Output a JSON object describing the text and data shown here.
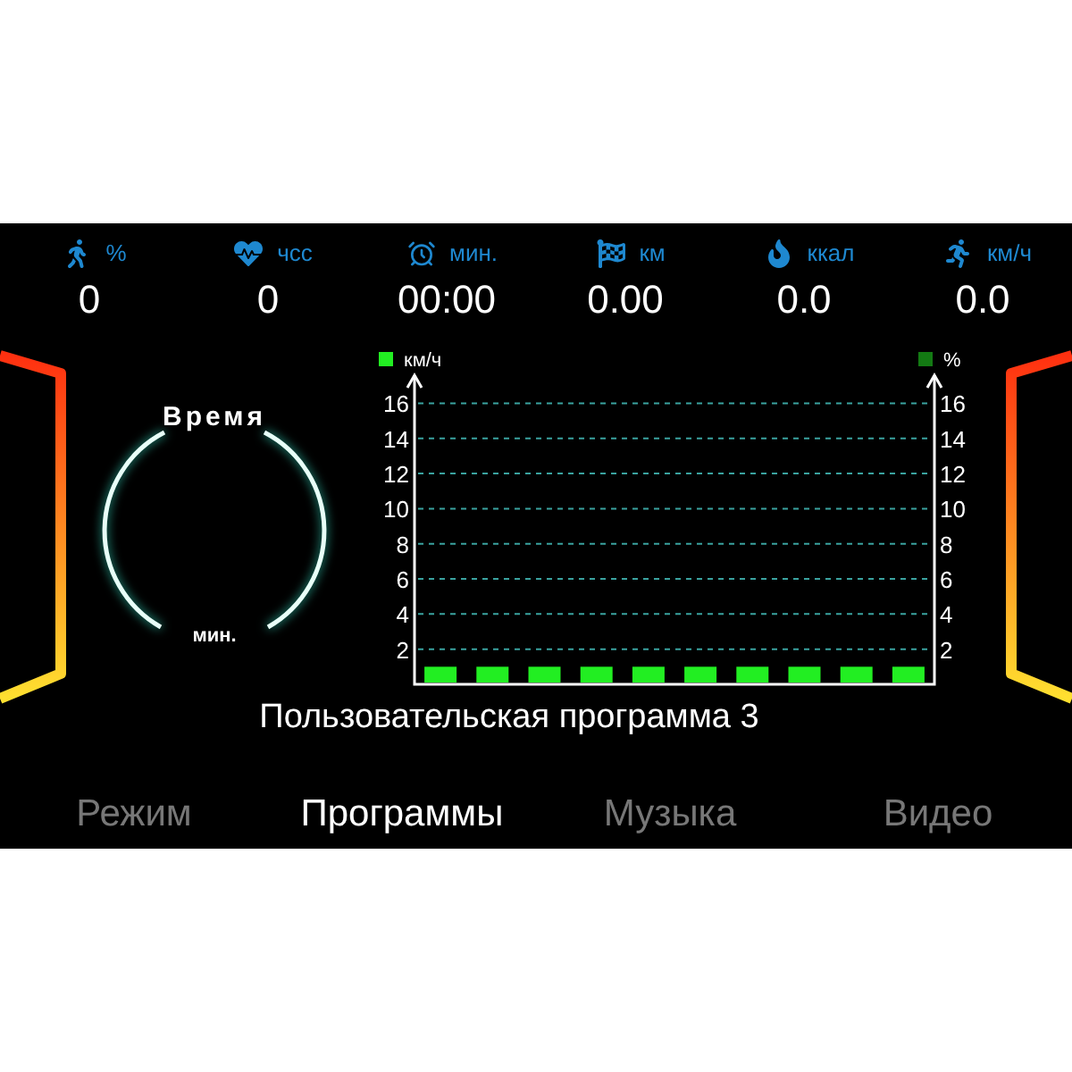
{
  "stats": [
    {
      "unit": "%",
      "value": "0"
    },
    {
      "unit": "чсс",
      "value": "0"
    },
    {
      "unit": "мин.",
      "value": "00:00"
    },
    {
      "unit": "км",
      "value": "0.00"
    },
    {
      "unit": "ккал",
      "value": "0.0"
    },
    {
      "unit": "км/ч",
      "value": "0.0"
    }
  ],
  "gauge": {
    "title": "Время",
    "unit": "мин."
  },
  "chart": {
    "title": "Пользовательская программа 3",
    "chart_data": {
      "type": "bar",
      "ylim": [
        0,
        17.6
      ],
      "yticks": [
        2,
        4,
        6,
        8,
        10,
        12,
        14,
        16
      ],
      "y2ticks": [
        2,
        4,
        6,
        8,
        10,
        12,
        14,
        16
      ],
      "y2lim": [
        0,
        17.6
      ],
      "grid": true,
      "series": [
        {
          "name": "км/ч",
          "color": "#22ee22",
          "values": [
            1,
            1,
            1,
            1,
            1,
            1,
            1,
            1,
            1,
            1
          ]
        },
        {
          "name": "%",
          "color": "#137a13",
          "values": [
            null,
            null,
            null,
            null,
            null,
            null,
            null,
            null,
            null,
            null
          ]
        }
      ]
    }
  },
  "tabs": [
    {
      "label": "Режим",
      "selected": false
    },
    {
      "label": "Программы",
      "selected": true
    },
    {
      "label": "Музыка",
      "selected": false
    },
    {
      "label": "Видео",
      "selected": false
    }
  ]
}
